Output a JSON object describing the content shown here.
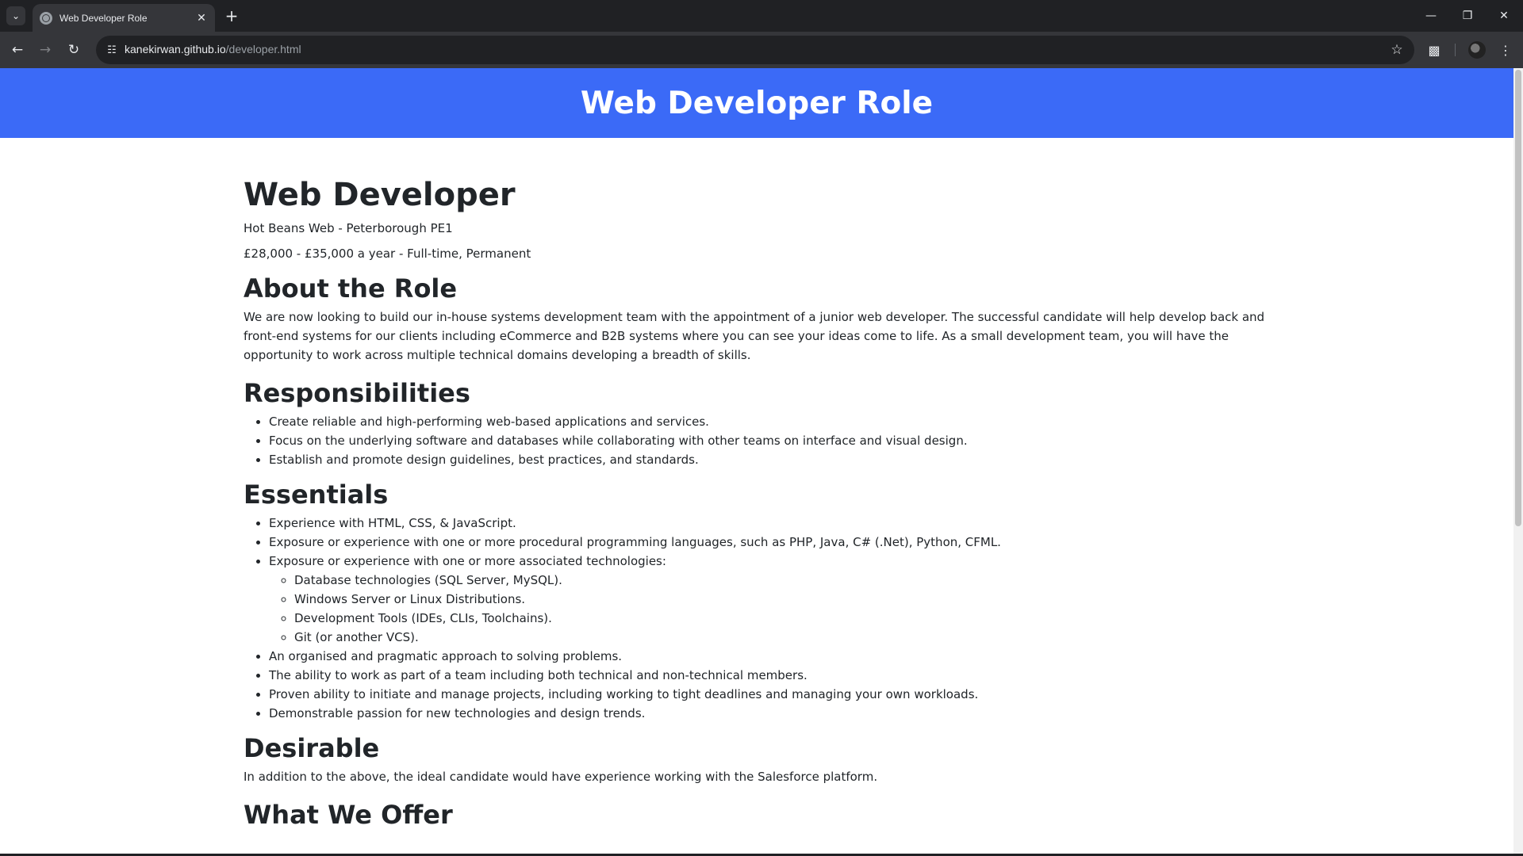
{
  "browser": {
    "tab_title": "Web Developer Role",
    "url_host": "kanekirwan.github.io",
    "url_path": "/developer.html"
  },
  "header": {
    "title": "Web Developer Role"
  },
  "job": {
    "title": "Web Developer",
    "company_location": "Hot Beans Web - Peterborough PE1",
    "salary": "£28,000 - £35,000 a year - Full-time, Permanent"
  },
  "about": {
    "heading": "About the Role",
    "text": "We are now looking to build our in-house systems development team with the appointment of a junior web developer. The successful candidate will help develop back and front-end systems for our clients including eCommerce and B2B systems where you can see your ideas come to life. As a small development team, you will have the opportunity to work across multiple technical domains developing a breadth of skills."
  },
  "responsibilities": {
    "heading": "Responsibilities",
    "items": [
      "Create reliable and high-performing web-based applications and services.",
      "Focus on the underlying software and databases while collaborating with other teams on interface and visual design.",
      "Establish and promote design guidelines, best practices, and standards."
    ]
  },
  "essentials": {
    "heading": "Essentials",
    "items": [
      "Experience with HTML, CSS, & JavaScript.",
      "Exposure or experience with one or more procedural programming languages, such as PHP, Java, C# (.Net), Python, CFML.",
      "Exposure or experience with one or more associated technologies:",
      "An organised and pragmatic approach to solving problems.",
      "The ability to work as part of a team including both technical and non-technical members.",
      "Proven ability to initiate and manage projects, including working to tight deadlines and managing your own workloads.",
      "Demonstrable passion for new technologies and design trends."
    ],
    "sub_items": [
      "Database technologies (SQL Server, MySQL).",
      "Windows Server or Linux Distributions.",
      "Development Tools (IDEs, CLIs, Toolchains).",
      "Git (or another VCS)."
    ]
  },
  "desirable": {
    "heading": "Desirable",
    "text": "In addition to the above, the ideal candidate would have experience working with the Salesforce platform."
  },
  "offer": {
    "heading": "What We Offer"
  },
  "colors": {
    "header_bg": "#3b6af7",
    "chrome_bg": "#202124",
    "toolbar_bg": "#35363a"
  },
  "icons": [
    "tab-search-icon",
    "globe-favicon-icon",
    "close-icon",
    "plus-icon",
    "minimize-icon",
    "restore-icon",
    "window-close-icon",
    "back-arrow-icon",
    "forward-arrow-icon",
    "reload-icon",
    "site-info-icon",
    "bookmark-star-icon",
    "extensions-puzzle-icon",
    "menu-dots-icon"
  ]
}
